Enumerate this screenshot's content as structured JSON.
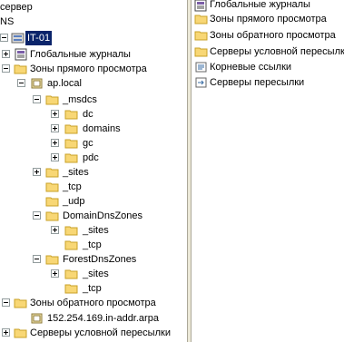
{
  "left_tree": {
    "items": [
      {
        "label": "сервер",
        "icon": "none"
      },
      {
        "label": "NS",
        "icon": "none"
      },
      {
        "label": "IT-01",
        "icon": "server-icon",
        "selected": true
      },
      {
        "label": "Глобальные журналы",
        "icon": "log-icon"
      },
      {
        "label": "Зоны прямого просмотра",
        "icon": "folder-icon"
      },
      {
        "label": "ap.local",
        "icon": "zone-icon"
      },
      {
        "label": "_msdcs",
        "icon": "folder-icon"
      },
      {
        "label": "dc",
        "icon": "folder-icon"
      },
      {
        "label": "domains",
        "icon": "folder-icon"
      },
      {
        "label": "gc",
        "icon": "folder-icon"
      },
      {
        "label": "pdc",
        "icon": "folder-icon"
      },
      {
        "label": "_sites",
        "icon": "folder-icon"
      },
      {
        "label": "_tcp",
        "icon": "folder-icon"
      },
      {
        "label": "_udp",
        "icon": "folder-icon"
      },
      {
        "label": "DomainDnsZones",
        "icon": "folder-icon"
      },
      {
        "label": "_sites",
        "icon": "folder-icon"
      },
      {
        "label": "_tcp",
        "icon": "folder-icon"
      },
      {
        "label": "ForestDnsZones",
        "icon": "folder-icon"
      },
      {
        "label": "_sites",
        "icon": "folder-icon"
      },
      {
        "label": "_tcp",
        "icon": "folder-icon"
      },
      {
        "label": "Зоны обратного просмотра",
        "icon": "folder-icon"
      },
      {
        "label": "152.254.169.in-addr.arpa",
        "icon": "zone-icon"
      },
      {
        "label": "Серверы условной пересылки",
        "icon": "folder-icon"
      }
    ]
  },
  "right_list": {
    "items": [
      {
        "label": "Глобальные журналы",
        "icon": "log-icon"
      },
      {
        "label": "Зоны прямого просмотра",
        "icon": "folder-icon"
      },
      {
        "label": "Зоны обратного просмотра",
        "icon": "folder-icon"
      },
      {
        "label": "Серверы условной пересылки",
        "icon": "folder-icon"
      },
      {
        "label": "Корневые ссылки",
        "icon": "root-hints-icon"
      },
      {
        "label": "Серверы пересылки",
        "icon": "forwarders-icon"
      }
    ]
  },
  "colors": {
    "folder_fill": "#f8d775",
    "folder_stroke": "#c9a227",
    "selection": "#0a246a"
  }
}
